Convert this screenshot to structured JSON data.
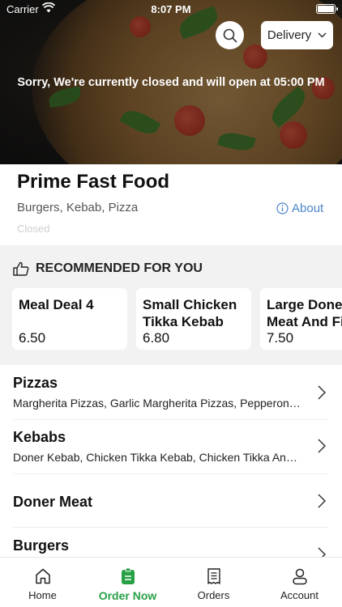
{
  "status_bar": {
    "carrier": "Carrier",
    "time": "8:07 PM"
  },
  "hero": {
    "closed_message": "Sorry, We're currently closed and will open at 05:00 PM",
    "delivery_label": "Delivery"
  },
  "store": {
    "name": "Prime Fast Food",
    "cuisines": "Burgers, Kebab, Pizza",
    "about_label": "About",
    "closed_label": "Closed"
  },
  "recommended": {
    "title": "RECOMMENDED FOR YOU",
    "items": [
      {
        "name": "Meal Deal 4",
        "price": "6.50"
      },
      {
        "name": "Small Chicken\nTikka Kebab",
        "price": "6.80"
      },
      {
        "name": "Large Doner\nMeat And Fi",
        "price": "7.50"
      }
    ]
  },
  "categories": [
    {
      "name": "Pizzas",
      "desc": "Margherita Pizzas, Garlic Margherita Pizzas, Pepperon…"
    },
    {
      "name": "Kebabs",
      "desc": "Doner Kebab, Chicken Tikka Kebab, Chicken Tikka An…"
    },
    {
      "name": "Doner Meat",
      "desc": ""
    },
    {
      "name": "Burgers",
      "desc": ""
    }
  ],
  "tabs": [
    {
      "label": "Home",
      "icon": "home-icon"
    },
    {
      "label": "Order Now",
      "icon": "order-now-icon"
    },
    {
      "label": "Orders",
      "icon": "orders-icon"
    },
    {
      "label": "Account",
      "icon": "account-icon"
    }
  ],
  "colors": {
    "accent_green": "#27a046",
    "link_blue": "#4a86c8",
    "section_bg": "#f2f2f2"
  }
}
